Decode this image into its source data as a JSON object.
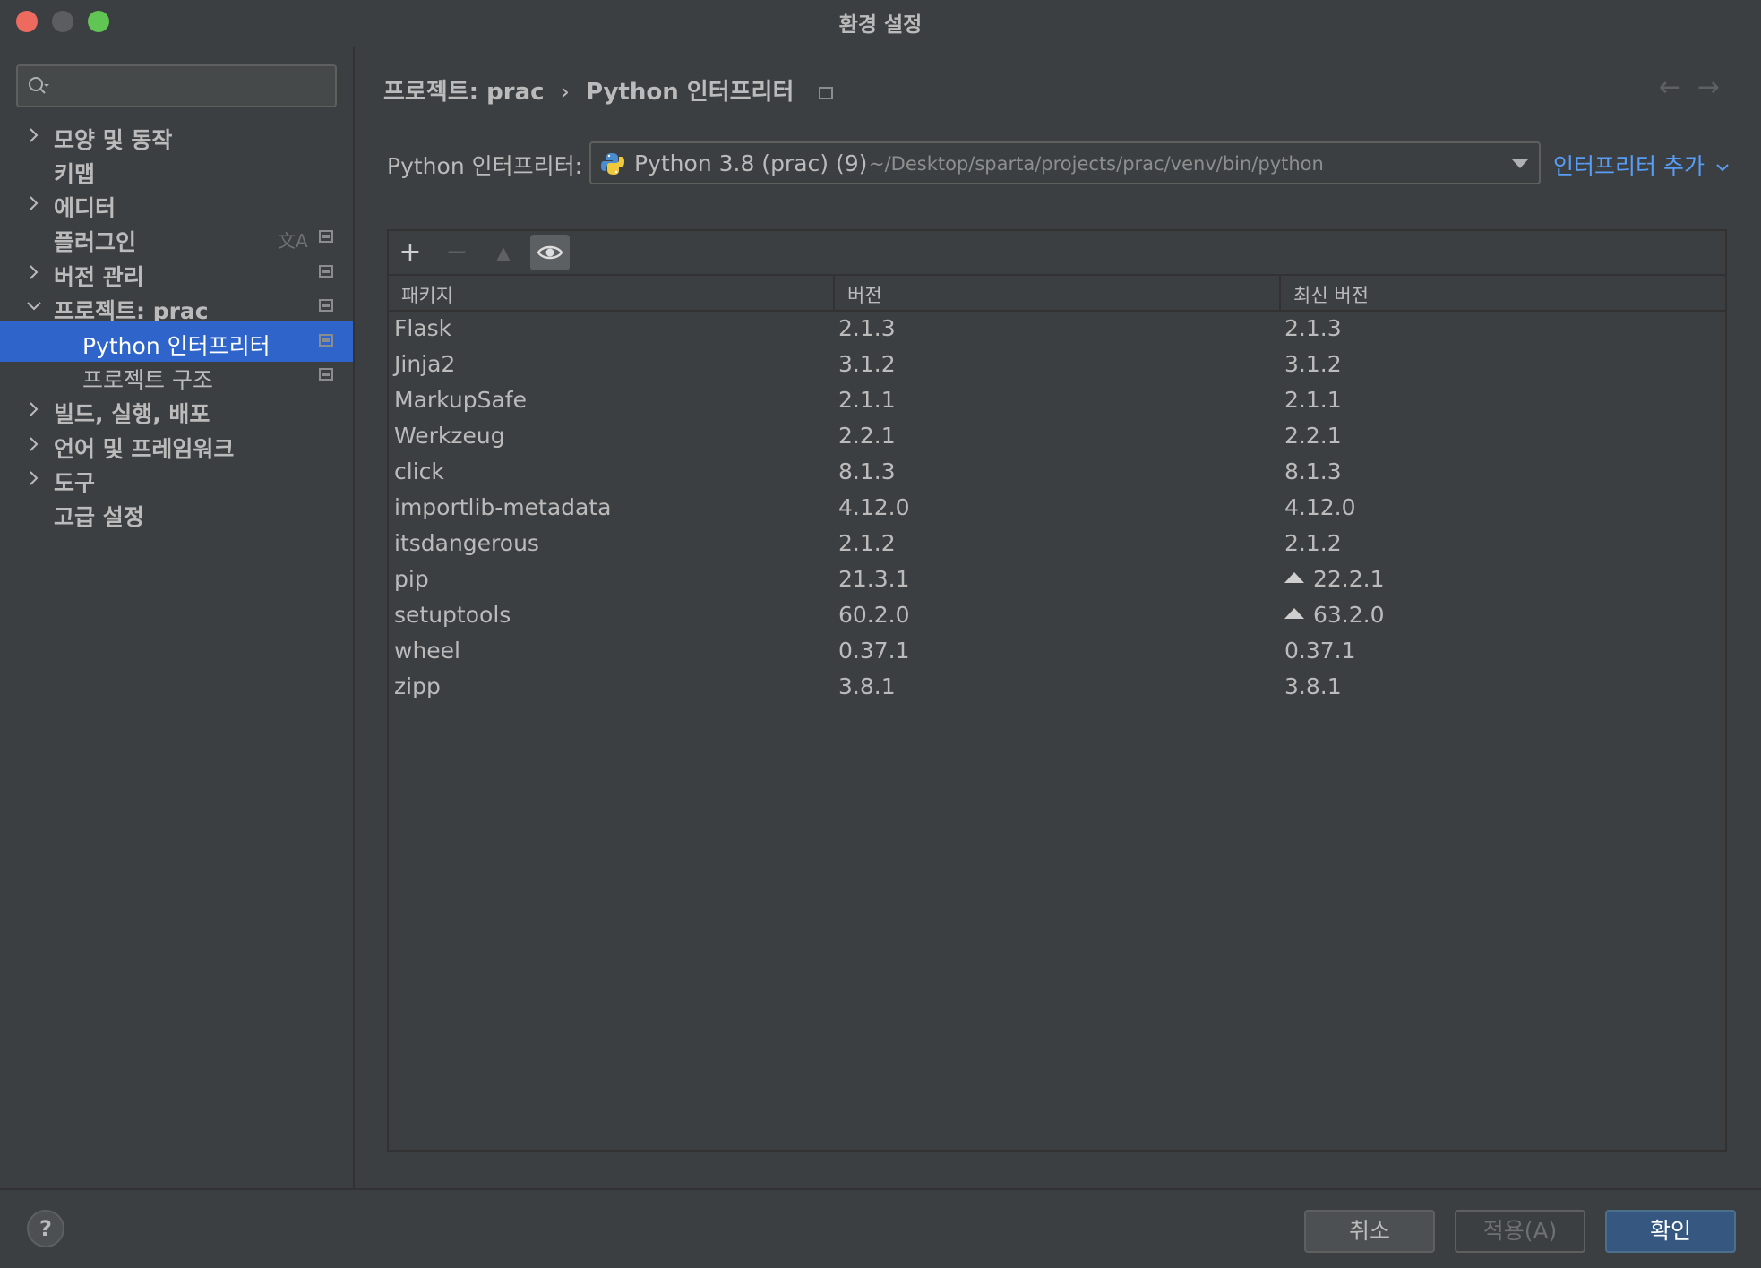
{
  "window": {
    "title": "환경 설정"
  },
  "sidebar": {
    "search": {
      "placeholder": ""
    },
    "items": [
      {
        "label": "모양 및 동작",
        "expandable": true,
        "expanded": false
      },
      {
        "label": "키맵",
        "expandable": false
      },
      {
        "label": "에디터",
        "expandable": true,
        "expanded": false
      },
      {
        "label": "플러그인",
        "expandable": false
      },
      {
        "label": "버전 관리",
        "expandable": true,
        "expanded": false
      },
      {
        "label": "프로젝트: prac",
        "expandable": true,
        "expanded": true
      },
      {
        "label": "Python 인터프리터",
        "child": true,
        "selected": true
      },
      {
        "label": "프로젝트 구조",
        "child": true
      },
      {
        "label": "빌드, 실행, 배포",
        "expandable": true,
        "expanded": false
      },
      {
        "label": "언어 및 프레임워크",
        "expandable": true,
        "expanded": false
      },
      {
        "label": "도구",
        "expandable": true,
        "expanded": false
      },
      {
        "label": "고급 설정",
        "expandable": false
      }
    ]
  },
  "breadcrumb": {
    "parent": "프로젝트: prac",
    "separator": "›",
    "current": "Python 인터프리터"
  },
  "interpreter": {
    "label": "Python 인터프리터:",
    "name": "Python 3.8 (prac) (9)",
    "path": "~/Desktop/sparta/projects/prac/venv/bin/python",
    "add_link": "인터프리터 추가"
  },
  "packages": {
    "toolbar": {
      "add": "+",
      "remove": "−",
      "upgrade": "▲",
      "show_early": "eye-icon"
    },
    "columns": [
      "패키지",
      "버전",
      "최신 버전"
    ],
    "rows": [
      {
        "name": "Flask",
        "version": "2.1.3",
        "latest": "2.1.3",
        "upgradable": false
      },
      {
        "name": "Jinja2",
        "version": "3.1.2",
        "latest": "3.1.2",
        "upgradable": false
      },
      {
        "name": "MarkupSafe",
        "version": "2.1.1",
        "latest": "2.1.1",
        "upgradable": false
      },
      {
        "name": "Werkzeug",
        "version": "2.2.1",
        "latest": "2.2.1",
        "upgradable": false
      },
      {
        "name": "click",
        "version": "8.1.3",
        "latest": "8.1.3",
        "upgradable": false
      },
      {
        "name": "importlib-metadata",
        "version": "4.12.0",
        "latest": "4.12.0",
        "upgradable": false
      },
      {
        "name": "itsdangerous",
        "version": "2.1.2",
        "latest": "2.1.2",
        "upgradable": false
      },
      {
        "name": "pip",
        "version": "21.3.1",
        "latest": "22.2.1",
        "upgradable": true
      },
      {
        "name": "setuptools",
        "version": "60.2.0",
        "latest": "63.2.0",
        "upgradable": true
      },
      {
        "name": "wheel",
        "version": "0.37.1",
        "latest": "0.37.1",
        "upgradable": false
      },
      {
        "name": "zipp",
        "version": "3.8.1",
        "latest": "3.8.1",
        "upgradable": false
      }
    ]
  },
  "footer": {
    "help": "?",
    "cancel": "취소",
    "apply": "적용(A)",
    "ok": "확인"
  },
  "colors": {
    "background": "#3c3f41",
    "selection": "#2f65ca",
    "link": "#589df6",
    "primary_button": "#365880"
  }
}
